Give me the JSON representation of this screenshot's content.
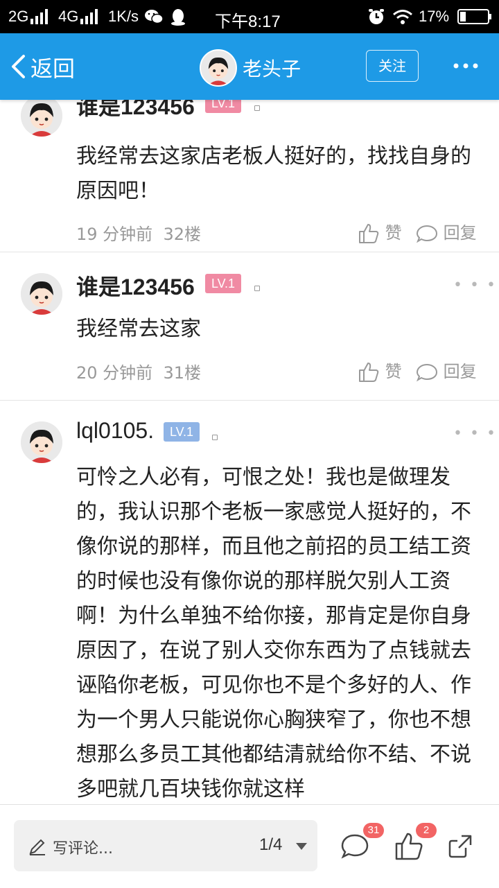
{
  "status_bar": {
    "network_2g": "2G",
    "network_4g": "4G",
    "speed": "1K/s",
    "time": "下午8:17",
    "battery": "17%"
  },
  "nav": {
    "back_label": "返回",
    "title": "老头子",
    "follow_label": "关注"
  },
  "comments": [
    {
      "username": "谁是123456",
      "level": "LV.1",
      "level_color": "#f08aa3",
      "text": "我经常去这家店老板人挺好的，找找自身的原因吧！",
      "time": "19 分钟前",
      "floor": "32楼",
      "like_label": "赞",
      "reply_label": "回复"
    },
    {
      "username": "谁是123456",
      "level": "LV.1",
      "level_color": "#f08aa3",
      "text": "我经常去这家",
      "time": "20 分钟前",
      "floor": "31楼",
      "like_label": "赞",
      "reply_label": "回复"
    },
    {
      "username": "lql0105.",
      "level": "LV.1",
      "level_color": "#8fb4e6",
      "text": "可怜之人必有，可恨之处！我也是做理发的，我认识那个老板一家感觉人挺好的，不像你说的那样，而且他之前招的员工结工资的时候也没有像你说的那样脱欠别人工资啊！为什么单独不给你接，那肯定是你自身原因了，在说了别人交你东西为了点钱就去诬陷你老板，可见你也不是个多好的人、作为一个男人只能说你心胸狭窄了，你也不想想那么多员工其他都结清就给你不结、不说多吧就几百块钱你就这样"
    }
  ],
  "bottom_bar": {
    "write_placeholder": "写评论...",
    "page_indicator": "1/4",
    "comment_count": "31",
    "like_count": "2"
  },
  "colors": {
    "nav_blue": "#1e9ae6",
    "badge_red": "#f26464"
  }
}
